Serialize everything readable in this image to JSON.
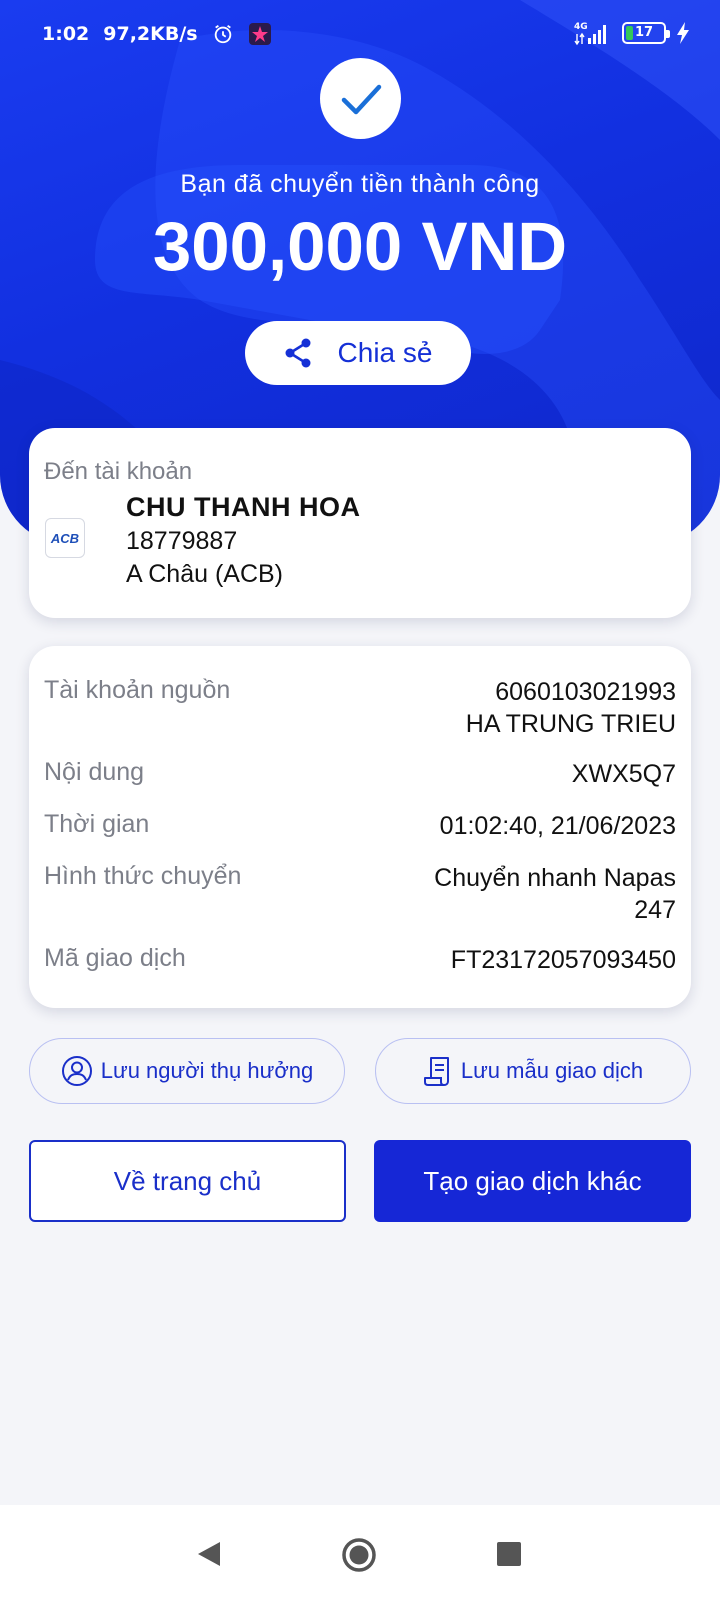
{
  "status_bar": {
    "time": "1:02",
    "speed": "97,2KB/s",
    "network": "4G",
    "battery": "17",
    "battery_level_percent": 17
  },
  "header": {
    "success_message": "Bạn đã chuyển tiền thành công",
    "amount": "300,000 VND",
    "share_label": "Chia sẻ"
  },
  "destination": {
    "label": "Đến tài khoản",
    "bank_logo_text": "ACB",
    "name": "CHU THANH HOA",
    "account_number": "18779887",
    "bank_name": "A Châu (ACB)"
  },
  "details": {
    "source_label": "Tài khoản nguồn",
    "source_account": "6060103021993",
    "source_name": "HA TRUNG TRIEU",
    "content_label": "Nội dung",
    "content_value": "XWX5Q7",
    "time_label": "Thời gian",
    "time_value": "01:02:40, 21/06/2023",
    "method_label": "Hình thức chuyển",
    "method_value_line1": "Chuyển nhanh Napas",
    "method_value_line2": "247",
    "txn_label": "Mã giao dịch",
    "txn_value": "FT23172057093450"
  },
  "actions": {
    "save_payee": "Lưu người thụ hưởng",
    "save_template": "Lưu mẫu giao dịch",
    "home": "Về trang chủ",
    "new_transaction": "Tạo giao dịch khác"
  },
  "colors": {
    "primary": "#1627d6",
    "hero": "#1a3cf0",
    "muted_text": "#7c7f89",
    "check": "#1a6fd8"
  }
}
